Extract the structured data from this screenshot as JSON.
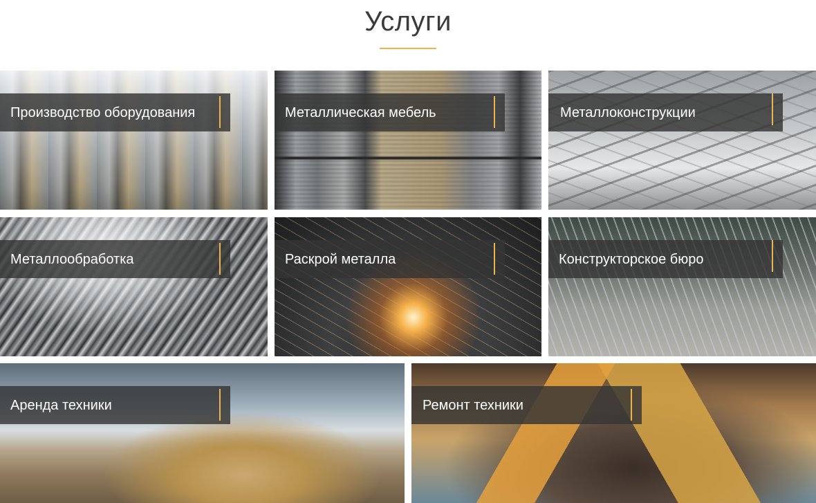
{
  "section": {
    "title": "Услуги"
  },
  "colors": {
    "accent": "#f0b24a",
    "label_background": "#343434",
    "title_text": "#3b3b3b"
  },
  "services": [
    {
      "label": "Производство оборудования"
    },
    {
      "label": "Металлическая мебель"
    },
    {
      "label": "Металлоконструкции"
    },
    {
      "label": "Металлообработка"
    },
    {
      "label": "Раскрой металла"
    },
    {
      "label": "Конструкторское бюро"
    },
    {
      "label": "Аренда техники"
    },
    {
      "label": "Ремонт техники"
    }
  ]
}
